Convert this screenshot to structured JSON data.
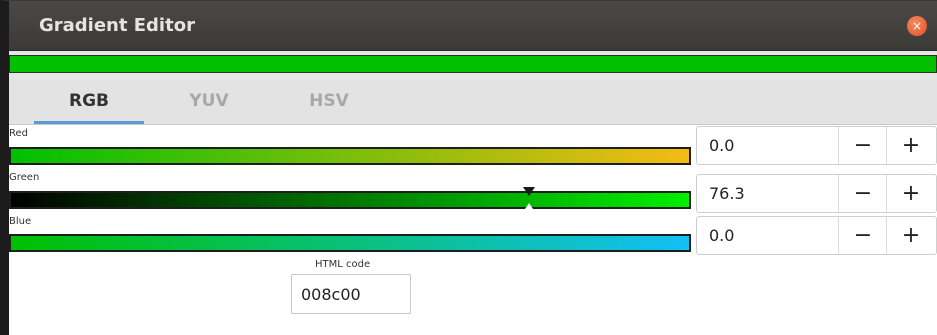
{
  "window": {
    "title": "Gradient Editor",
    "close_icon": "close-icon",
    "close_glyph": "×"
  },
  "preview_color": "#00c000",
  "tabs": [
    {
      "label": "RGB",
      "active": true
    },
    {
      "label": "YUV",
      "active": false
    },
    {
      "label": "HSV",
      "active": false
    }
  ],
  "channels": [
    {
      "label": "Red",
      "value": "0.0",
      "minus": "−",
      "plus": "+",
      "gradient_start": "#00c000",
      "gradient_end": "#f5bb14",
      "marker_fraction": null
    },
    {
      "label": "Green",
      "value": "76.3",
      "minus": "−",
      "plus": "+",
      "gradient_start": "#000000",
      "gradient_end": "#00f000",
      "marker_fraction": 0.763
    },
    {
      "label": "Blue",
      "value": "0.0",
      "minus": "−",
      "plus": "+",
      "gradient_start": "#00c000",
      "gradient_end": "#12c0f5",
      "marker_fraction": null
    }
  ],
  "html_code": {
    "label": "HTML code",
    "value": "008c00"
  }
}
